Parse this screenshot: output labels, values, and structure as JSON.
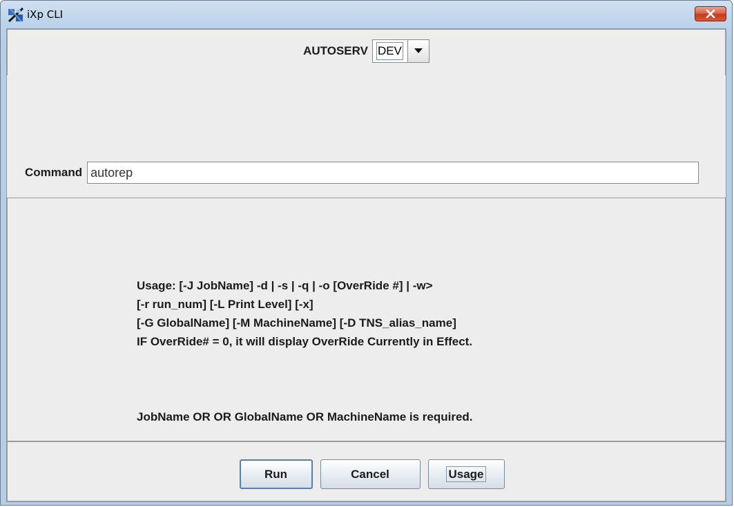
{
  "window": {
    "title": "iXp CLI",
    "icon": "ixp-app-icon",
    "close_icon": "close-x-icon",
    "close_color": "#c7391f"
  },
  "server": {
    "label": "AUTOSERV",
    "selected": "DEV",
    "arrow_icon": "triangle-down-icon"
  },
  "command": {
    "label": "Command",
    "value": "autorep"
  },
  "usage": {
    "lines": [
      "Usage: [-J JobName] -d | -s | -q | -o [OverRide #] | -w>",
      "[-r run_num] [-L Print Level] [-x]",
      "[-G GlobalName] [-M MachineName] [-D TNS_alias_name]",
      "IF OverRide# = 0, it will display OverRide Currently in Effect."
    ],
    "required": "JobName OR OR GlobalName OR MachineName is required."
  },
  "buttons": {
    "run": "Run",
    "cancel": "Cancel",
    "usage": "Usage"
  }
}
